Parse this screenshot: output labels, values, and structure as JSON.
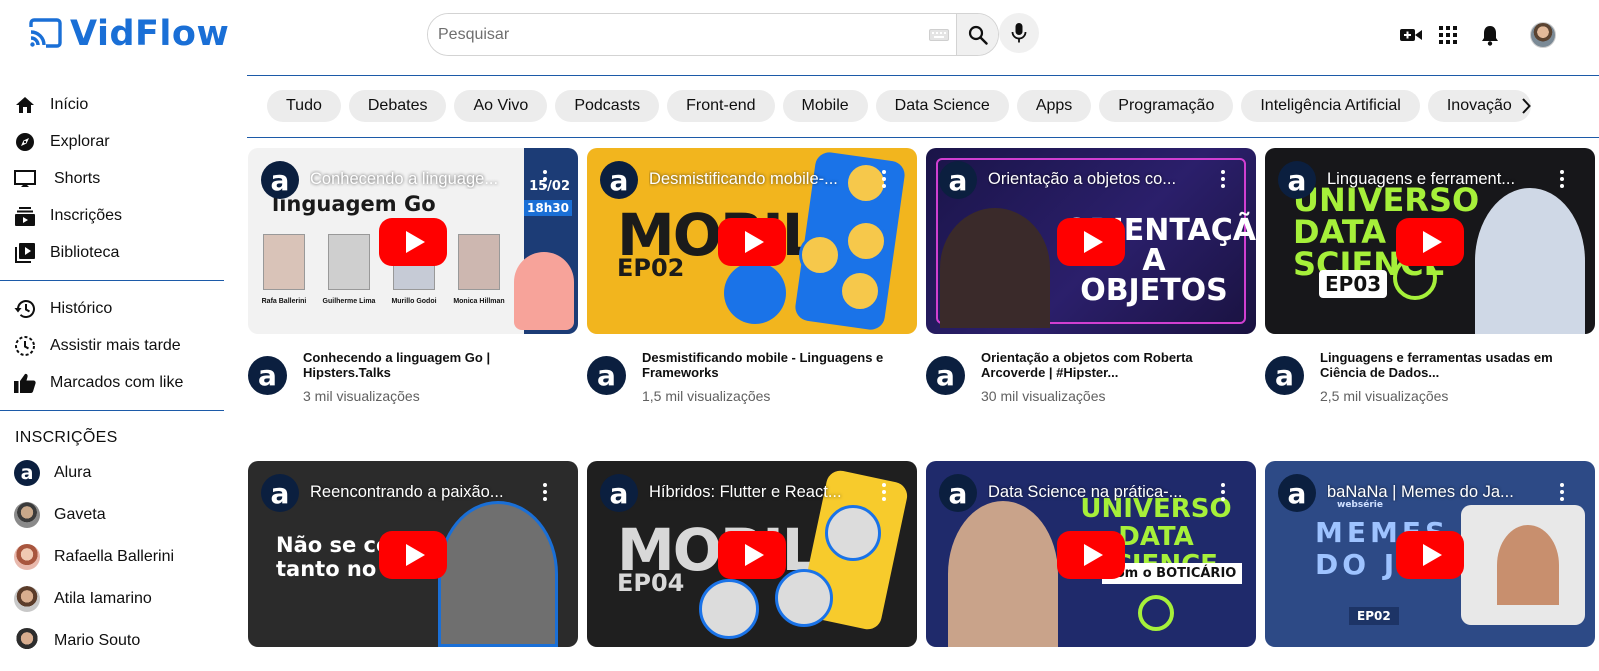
{
  "brand": {
    "name": "VidFlow",
    "accent": "#1a6fd6"
  },
  "search": {
    "placeholder": "Pesquisar",
    "value": ""
  },
  "header_icons": [
    "create-video-icon",
    "apps-grid-icon",
    "notifications-bell-icon",
    "user-avatar"
  ],
  "sidebar": {
    "primary": [
      {
        "label": "Início",
        "icon": "home-icon"
      },
      {
        "label": "Explorar",
        "icon": "compass-icon"
      },
      {
        "label": "Shorts",
        "icon": "shorts-icon"
      },
      {
        "label": "Inscrições",
        "icon": "subscriptions-icon"
      },
      {
        "label": "Biblioteca",
        "icon": "library-icon"
      }
    ],
    "secondary": [
      {
        "label": "Histórico",
        "icon": "history-icon"
      },
      {
        "label": "Assistir mais tarde",
        "icon": "watch-later-icon"
      },
      {
        "label": "Marcados com like",
        "icon": "thumbs-up-icon"
      }
    ],
    "subscriptions_title": "INSCRIÇÕES",
    "subscriptions": [
      {
        "name": "Alura"
      },
      {
        "name": "Gaveta"
      },
      {
        "name": "Rafaella Ballerini"
      },
      {
        "name": "Atila Iamarino"
      },
      {
        "name": "Mario Souto"
      }
    ]
  },
  "chips": [
    "Tudo",
    "Debates",
    "Ao Vivo",
    "Podcasts",
    "Front-end",
    "Mobile",
    "Data Science",
    "Apps",
    "Programação",
    "Inteligência Artificial",
    "Inovação"
  ],
  "videos": [
    {
      "overlay_title": "Conhecendo a linguage...",
      "title": "Conhecendo a linguagem Go | Hipsters.Talks",
      "views": "3 mil visualizações",
      "thumb_text": "linguagem Go",
      "thumb_date": "15/02",
      "thumb_time": "18h30",
      "speakers": [
        "Rafa Ballerini",
        "Guilherme Lima",
        "Murillo Godoi",
        "Monica Hillman"
      ]
    },
    {
      "overlay_title": "Desmistificando mobile-...",
      "title": "Desmistificando mobile - Linguagens e Frameworks",
      "views": "1,5 mil visualizações",
      "thumb_big": "MOBILE",
      "thumb_ep": "EP02"
    },
    {
      "overlay_title": "Orientação a objetos co...",
      "title": "Orientação a objetos com Roberta Arcoverde | #Hipster...",
      "views": "30 mil visualizações",
      "thumb_big": "ORIENTAÇÃO A OBJETOS"
    },
    {
      "overlay_title": "Linguagens e ferrament...",
      "title": "Linguagens e ferramentas usadas em Ciência de Dados...",
      "views": "2,5 mil visualizações",
      "thumb_big": "UNIVERSO DATA SCIENCE",
      "thumb_ep": "EP03"
    },
    {
      "overlay_title": "Reencontrando a paixão...",
      "title": "",
      "views": "",
      "thumb_big": "Não se co tanto no i"
    },
    {
      "overlay_title": "Híbridos: Flutter e React...",
      "title": "",
      "views": "",
      "thumb_big": "MOBILE",
      "thumb_ep": "EP04"
    },
    {
      "overlay_title": "Data Science na prática-...",
      "title": "",
      "views": "",
      "thumb_big": "UNIVERSO DATA SCIENCE",
      "thumb_sub": "com o BOTICÁRIO"
    },
    {
      "overlay_title": "baNaNa | Memes do Ja...",
      "title": "",
      "views": "",
      "thumb_big": "MEMES DO JS",
      "thumb_ep": "EP02",
      "thumb_sub": "websérie"
    }
  ]
}
